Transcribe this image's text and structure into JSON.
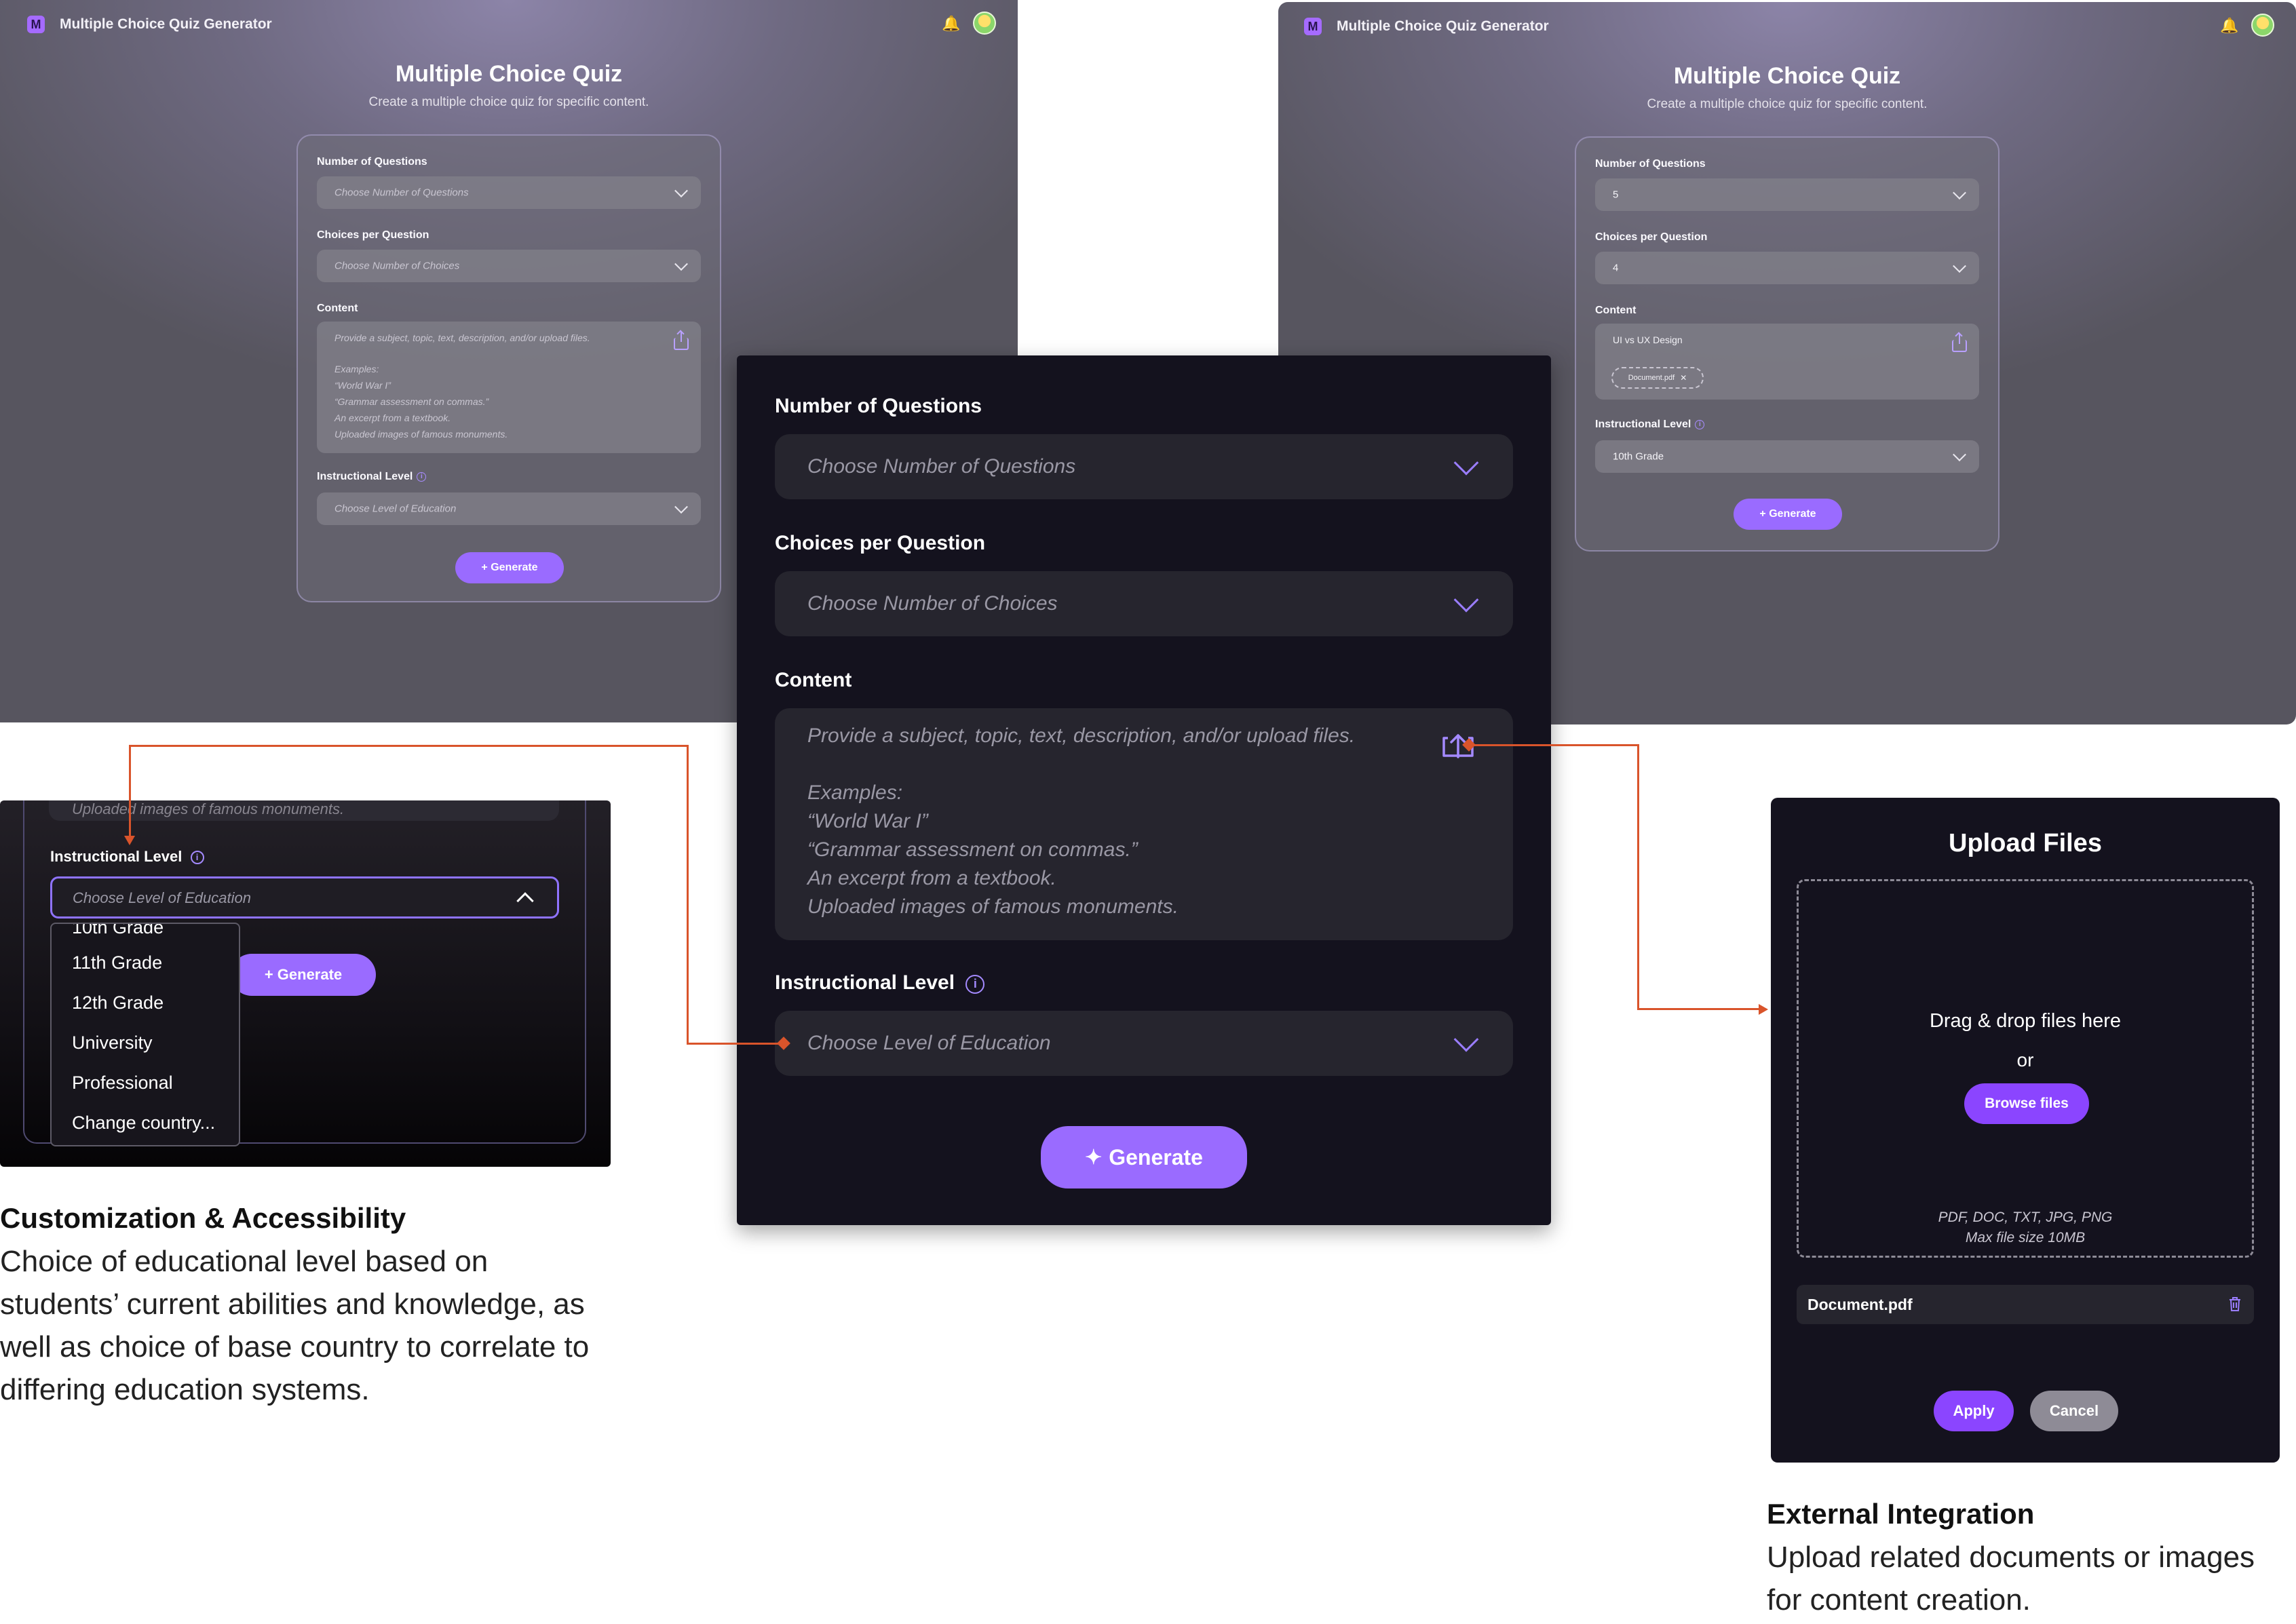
{
  "app": {
    "logo_letter": "M",
    "title": "Multiple Choice Quiz Generator",
    "heading": "Multiple Choice Quiz",
    "subheading": "Create a multiple choice quiz for specific content.",
    "icons": [
      "bell-icon",
      "avatar"
    ]
  },
  "form": {
    "questions_label": "Number of Questions",
    "questions_placeholder": "Choose Number of Questions",
    "choices_label": "Choices per Question",
    "choices_placeholder": "Choose Number of Choices",
    "content_label": "Content",
    "content_placeholder": "Provide a subject, topic, text, description, and/or upload files.",
    "content_examples": [
      "Examples:",
      "“World War I”",
      "“Grammar assessment on commas.”",
      "An excerpt from a textbook.",
      "Uploaded images of famous monuments."
    ],
    "level_label": "Instructional Level",
    "level_placeholder": "Choose Level of Education",
    "generate_label": "+ Generate",
    "generate_label_large": "Generate"
  },
  "filled_form": {
    "questions_value": "5",
    "choices_value": "4",
    "content_value": "UI vs UX Design",
    "attachment_chip": "Document.pdf",
    "level_value": "10th Grade"
  },
  "level_dropdown": {
    "partial_item": "10th Grade",
    "options": [
      "11th Grade",
      "12th Grade",
      "University",
      "Professional",
      "Change country..."
    ],
    "truncated_above": "Uploaded images of famous monuments."
  },
  "upload_dialog": {
    "title": "Upload Files",
    "drop_text": "Drag & drop files here",
    "or_text": "or",
    "browse_label": "Browse files",
    "formats": "PDF, DOC, TXT, JPG, PNG",
    "max_size": "Max file size 10MB",
    "file_name": "Document.pdf",
    "apply_label": "Apply",
    "cancel_label": "Cancel"
  },
  "captions": {
    "left_title": "Customization & Accessibility",
    "left_body": "Choice of educational level based on students’ current abilities and knowledge, as well as choice of base country to correlate to differing education systems.",
    "right_title": "External Integration",
    "right_body": "Upload related documents or images for content creation."
  },
  "colors": {
    "accent": "#9a6bff",
    "connector": "#d9542b",
    "panel_dark": "#14121e"
  }
}
